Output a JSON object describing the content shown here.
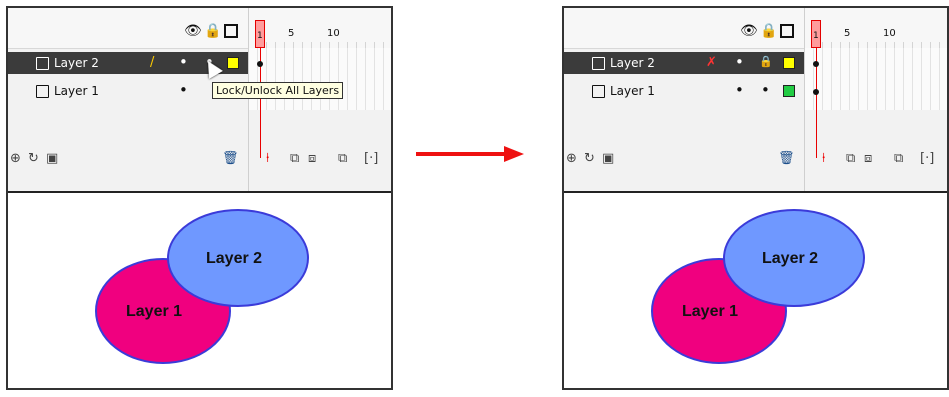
{
  "before": {
    "layers": [
      {
        "name": "Layer 2",
        "selected": true,
        "icon": "pencil-icon",
        "swatch": "#ffff00"
      },
      {
        "name": "Layer 1",
        "selected": false,
        "swatch": "#ffff00"
      }
    ],
    "ruler": [
      "1",
      "5",
      "10"
    ],
    "tooltip": "Lock/Unlock All Layers"
  },
  "after": {
    "layers": [
      {
        "name": "Layer 2",
        "selected": true,
        "icon": "crossed-pencil-icon",
        "swatch": "#ffff00"
      },
      {
        "name": "Layer 1",
        "selected": false,
        "swatch": "#22cc44"
      }
    ],
    "ruler": [
      "1",
      "5",
      "10"
    ]
  },
  "stage": {
    "layer1_label": "Layer 1",
    "layer2_label": "Layer 2",
    "layer1_fill": "#f0007f",
    "layer2_fill": "#6f98ff",
    "outline": "#3b3bd9"
  },
  "arrow_color": "#ee1111"
}
